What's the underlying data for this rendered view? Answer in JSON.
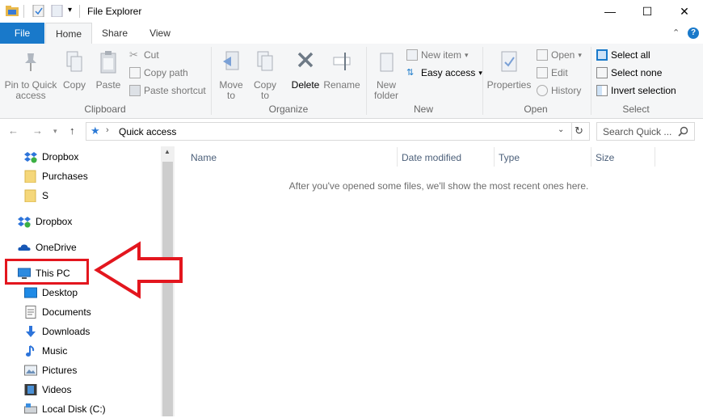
{
  "window": {
    "title": "File Explorer",
    "controls": {
      "minimize": "—",
      "maximize": "☐",
      "close": "✕"
    }
  },
  "tabs": [
    {
      "label": "File"
    },
    {
      "label": "Home"
    },
    {
      "label": "Share"
    },
    {
      "label": "View"
    }
  ],
  "ribbon": {
    "clipboard": {
      "group_label": "Clipboard",
      "pin_label": "Pin to Quick access",
      "copy_label": "Copy",
      "paste_label": "Paste",
      "cut_label": "Cut",
      "copy_path_label": "Copy path",
      "paste_shortcut_label": "Paste shortcut"
    },
    "organize": {
      "group_label": "Organize",
      "move_to_label": "Move to",
      "copy_to_label": "Copy to",
      "delete_label": "Delete",
      "rename_label": "Rename"
    },
    "new": {
      "group_label": "New",
      "new_folder_label": "New folder",
      "new_item_label": "New item",
      "easy_access_label": "Easy access"
    },
    "open": {
      "group_label": "Open",
      "properties_label": "Properties",
      "open_label": "Open",
      "edit_label": "Edit",
      "history_label": "History"
    },
    "select": {
      "group_label": "Select",
      "select_all_label": "Select all",
      "select_none_label": "Select none",
      "invert_label": "Invert selection"
    }
  },
  "address": {
    "path": "Quick access",
    "search_placeholder": "Search Quick ..."
  },
  "nav": {
    "items": [
      {
        "label": "Dropbox"
      },
      {
        "label": "Purchases"
      },
      {
        "label": "S"
      },
      {
        "label": "Dropbox"
      },
      {
        "label": "OneDrive"
      },
      {
        "label": "This PC"
      },
      {
        "label": "Desktop"
      },
      {
        "label": "Documents"
      },
      {
        "label": "Downloads"
      },
      {
        "label": "Music"
      },
      {
        "label": "Pictures"
      },
      {
        "label": "Videos"
      },
      {
        "label": "Local Disk (C:)"
      }
    ]
  },
  "content": {
    "columns": [
      "Name",
      "Date modified",
      "Type",
      "Size"
    ],
    "empty_message": "After you've opened some files, we'll show the most recent ones here."
  },
  "colors": {
    "accent": "#1979ca",
    "annotation": "#e3161e"
  }
}
